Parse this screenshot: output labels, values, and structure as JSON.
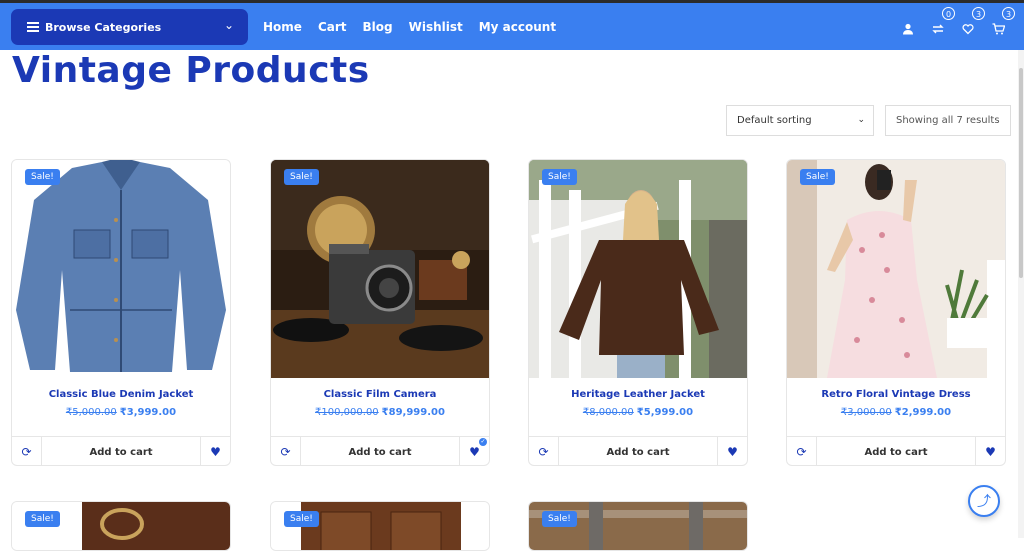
{
  "header": {
    "browse_label": "Browse Categories",
    "nav": [
      "Home",
      "Cart",
      "Blog",
      "Wishlist",
      "My account"
    ],
    "badges": {
      "compare": "0",
      "wishlist": "3",
      "cart": "3"
    },
    "icons": [
      "user-icon",
      "compare-icon",
      "wishlist-icon",
      "cart-icon"
    ]
  },
  "page": {
    "title": "Vintage Products"
  },
  "toolbar": {
    "sort_label": "Default sorting",
    "results": "Showing all 7 results"
  },
  "sale_label": "Sale!",
  "add_to_cart_label": "Add to cart",
  "products": [
    {
      "name": "Classic Blue Denim Jacket",
      "old_price": "₹5,000.00",
      "price": "₹3,999.00"
    },
    {
      "name": "Classic Film Camera",
      "old_price": "₹100,000.00",
      "price": "₹89,999.00"
    },
    {
      "name": "Heritage Leather Jacket",
      "old_price": "₹8,000.00",
      "price": "₹5,999.00"
    },
    {
      "name": "Retro Floral Vintage Dress",
      "old_price": "₹3,000.00",
      "price": "₹2,999.00"
    }
  ],
  "colors": {
    "accent": "#3a7ff0",
    "brand": "#1b39b5"
  }
}
